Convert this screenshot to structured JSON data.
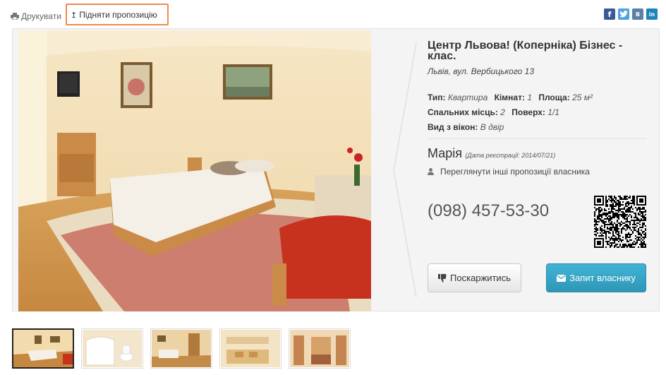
{
  "toolbar": {
    "print_label": "Друкувати",
    "raise_label": "Підняти пропозицію"
  },
  "social": {
    "facebook": "f",
    "twitter": "t",
    "vkontakte": "В",
    "linkedin": "in"
  },
  "listing": {
    "title": "Центр Львова! (Коперніка) Бізнес - клас.",
    "address": "Львів, вул. Вербицького 13",
    "type_label": "Тип:",
    "type_value": "Квартира",
    "rooms_label": "Кімнат:",
    "rooms_value": "1",
    "area_label": "Площа:",
    "area_value": "25 м²",
    "beds_label": "Спальних місць:",
    "beds_value": "2",
    "floor_label": "Поверх:",
    "floor_value": "1/1",
    "view_label": "Вид з вікон:",
    "view_value": "В двір"
  },
  "owner": {
    "name": "Марія",
    "registered": "(Дата реєстрації: 2014/07/21)",
    "other_offers": "Переглянути інші пропозиції власника",
    "phone": "(098) 457-53-30"
  },
  "buttons": {
    "complain": "Поскаржитись",
    "request": "Запит власнику"
  },
  "icons": {
    "print": "print-icon",
    "raise": "arrow-up-icon",
    "user": "user-icon",
    "thumbs_down": "thumbs-down-icon",
    "envelope": "envelope-icon"
  },
  "colors": {
    "highlight": "#f08a4b",
    "request_button": "#37a5c6"
  },
  "thumbnails": [
    "bedroom",
    "bathroom",
    "room",
    "kitchen",
    "hallway"
  ]
}
